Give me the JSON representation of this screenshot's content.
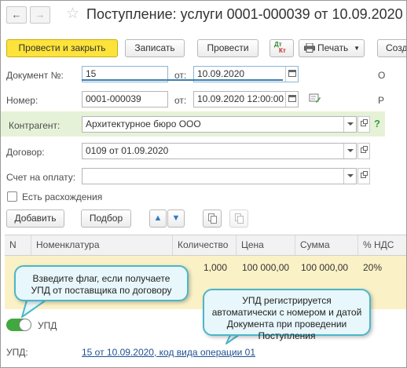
{
  "header": {
    "title": "Поступление: услуги 0001-000039 от 10.09.2020",
    "back_glyph": "←",
    "forward_glyph": "→",
    "star_glyph": "☆"
  },
  "toolbar": {
    "post_close": "Провести и закрыть",
    "save": "Записать",
    "post": "Провести",
    "dt_label": "Дт",
    "kt_label": "Кт",
    "print": "Печать",
    "create_cut": "Созд"
  },
  "form": {
    "doc_no_label": "Документ №:",
    "doc_no_value": "15",
    "from_label": "от:",
    "doc_date_value": "10.09.2020",
    "number_label": "Номер:",
    "number_value": "0001-000039",
    "number_date_value": "10.09.2020 12:00:00",
    "right_cut_o": "О",
    "right_cut_r": "Р",
    "counterparty_label": "Контрагент:",
    "counterparty_value": "Архитектурное бюро ООО",
    "help_glyph": "?",
    "contract_label": "Договор:",
    "contract_value": "0109 от 01.09.2020",
    "invoice_label": "Счет на оплату:",
    "invoice_value": "",
    "discrepancy_label": "Есть расхождения",
    "discrepancy_checked": false
  },
  "table_toolbar": {
    "add": "Добавить",
    "pick": "Подбор",
    "up_glyph": "▲",
    "down_glyph": "▼"
  },
  "table": {
    "columns": [
      "N",
      "Номенклатура",
      "Количество",
      "Цена",
      "Сумма",
      "% НДС"
    ],
    "rows": [
      {
        "n": "",
        "item": "",
        "qty": "1,000",
        "price": "100 000,00",
        "sum": "100 000,00",
        "vat": "20%"
      }
    ]
  },
  "callouts": {
    "left": "Взведите флаг, если получаете УПД от поставщика по договору",
    "right": "УПД регистрируется автоматически с номером и датой Документа при проведении Поступления"
  },
  "upd": {
    "toggle_label": "УПД",
    "toggle_on": true,
    "label": "УПД:",
    "link": "15 от 10.09.2020, код вида операции 01"
  },
  "colors": {
    "primary_button": "#fde33a",
    "highlight_band": "#e6f2d8",
    "row_highlight": "#fbf1c6",
    "callout_bg": "#e8f7fb",
    "callout_border": "#4bb6c9",
    "toggle_on": "#41a83f",
    "link": "#1f4f95"
  }
}
